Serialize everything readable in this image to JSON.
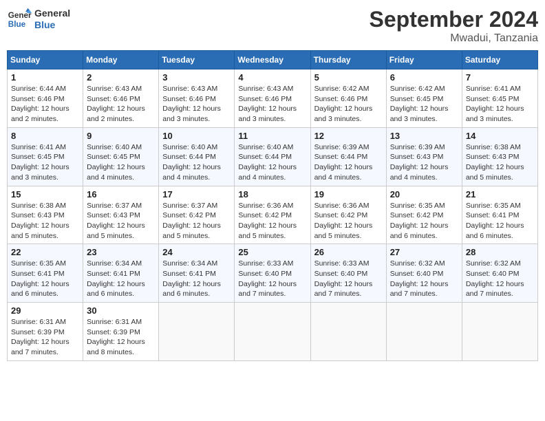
{
  "header": {
    "logo_line1": "General",
    "logo_line2": "Blue",
    "month": "September 2024",
    "location": "Mwadui, Tanzania"
  },
  "days_of_week": [
    "Sunday",
    "Monday",
    "Tuesday",
    "Wednesday",
    "Thursday",
    "Friday",
    "Saturday"
  ],
  "weeks": [
    [
      {
        "day": "1",
        "info": "Sunrise: 6:44 AM\nSunset: 6:46 PM\nDaylight: 12 hours\nand 2 minutes."
      },
      {
        "day": "2",
        "info": "Sunrise: 6:43 AM\nSunset: 6:46 PM\nDaylight: 12 hours\nand 2 minutes."
      },
      {
        "day": "3",
        "info": "Sunrise: 6:43 AM\nSunset: 6:46 PM\nDaylight: 12 hours\nand 3 minutes."
      },
      {
        "day": "4",
        "info": "Sunrise: 6:43 AM\nSunset: 6:46 PM\nDaylight: 12 hours\nand 3 minutes."
      },
      {
        "day": "5",
        "info": "Sunrise: 6:42 AM\nSunset: 6:46 PM\nDaylight: 12 hours\nand 3 minutes."
      },
      {
        "day": "6",
        "info": "Sunrise: 6:42 AM\nSunset: 6:45 PM\nDaylight: 12 hours\nand 3 minutes."
      },
      {
        "day": "7",
        "info": "Sunrise: 6:41 AM\nSunset: 6:45 PM\nDaylight: 12 hours\nand 3 minutes."
      }
    ],
    [
      {
        "day": "8",
        "info": "Sunrise: 6:41 AM\nSunset: 6:45 PM\nDaylight: 12 hours\nand 3 minutes."
      },
      {
        "day": "9",
        "info": "Sunrise: 6:40 AM\nSunset: 6:45 PM\nDaylight: 12 hours\nand 4 minutes."
      },
      {
        "day": "10",
        "info": "Sunrise: 6:40 AM\nSunset: 6:44 PM\nDaylight: 12 hours\nand 4 minutes."
      },
      {
        "day": "11",
        "info": "Sunrise: 6:40 AM\nSunset: 6:44 PM\nDaylight: 12 hours\nand 4 minutes."
      },
      {
        "day": "12",
        "info": "Sunrise: 6:39 AM\nSunset: 6:44 PM\nDaylight: 12 hours\nand 4 minutes."
      },
      {
        "day": "13",
        "info": "Sunrise: 6:39 AM\nSunset: 6:43 PM\nDaylight: 12 hours\nand 4 minutes."
      },
      {
        "day": "14",
        "info": "Sunrise: 6:38 AM\nSunset: 6:43 PM\nDaylight: 12 hours\nand 5 minutes."
      }
    ],
    [
      {
        "day": "15",
        "info": "Sunrise: 6:38 AM\nSunset: 6:43 PM\nDaylight: 12 hours\nand 5 minutes."
      },
      {
        "day": "16",
        "info": "Sunrise: 6:37 AM\nSunset: 6:43 PM\nDaylight: 12 hours\nand 5 minutes."
      },
      {
        "day": "17",
        "info": "Sunrise: 6:37 AM\nSunset: 6:42 PM\nDaylight: 12 hours\nand 5 minutes."
      },
      {
        "day": "18",
        "info": "Sunrise: 6:36 AM\nSunset: 6:42 PM\nDaylight: 12 hours\nand 5 minutes."
      },
      {
        "day": "19",
        "info": "Sunrise: 6:36 AM\nSunset: 6:42 PM\nDaylight: 12 hours\nand 5 minutes."
      },
      {
        "day": "20",
        "info": "Sunrise: 6:35 AM\nSunset: 6:42 PM\nDaylight: 12 hours\nand 6 minutes."
      },
      {
        "day": "21",
        "info": "Sunrise: 6:35 AM\nSunset: 6:41 PM\nDaylight: 12 hours\nand 6 minutes."
      }
    ],
    [
      {
        "day": "22",
        "info": "Sunrise: 6:35 AM\nSunset: 6:41 PM\nDaylight: 12 hours\nand 6 minutes."
      },
      {
        "day": "23",
        "info": "Sunrise: 6:34 AM\nSunset: 6:41 PM\nDaylight: 12 hours\nand 6 minutes."
      },
      {
        "day": "24",
        "info": "Sunrise: 6:34 AM\nSunset: 6:41 PM\nDaylight: 12 hours\nand 6 minutes."
      },
      {
        "day": "25",
        "info": "Sunrise: 6:33 AM\nSunset: 6:40 PM\nDaylight: 12 hours\nand 7 minutes."
      },
      {
        "day": "26",
        "info": "Sunrise: 6:33 AM\nSunset: 6:40 PM\nDaylight: 12 hours\nand 7 minutes."
      },
      {
        "day": "27",
        "info": "Sunrise: 6:32 AM\nSunset: 6:40 PM\nDaylight: 12 hours\nand 7 minutes."
      },
      {
        "day": "28",
        "info": "Sunrise: 6:32 AM\nSunset: 6:40 PM\nDaylight: 12 hours\nand 7 minutes."
      }
    ],
    [
      {
        "day": "29",
        "info": "Sunrise: 6:31 AM\nSunset: 6:39 PM\nDaylight: 12 hours\nand 7 minutes."
      },
      {
        "day": "30",
        "info": "Sunrise: 6:31 AM\nSunset: 6:39 PM\nDaylight: 12 hours\nand 8 minutes."
      },
      {
        "day": "",
        "info": ""
      },
      {
        "day": "",
        "info": ""
      },
      {
        "day": "",
        "info": ""
      },
      {
        "day": "",
        "info": ""
      },
      {
        "day": "",
        "info": ""
      }
    ]
  ]
}
